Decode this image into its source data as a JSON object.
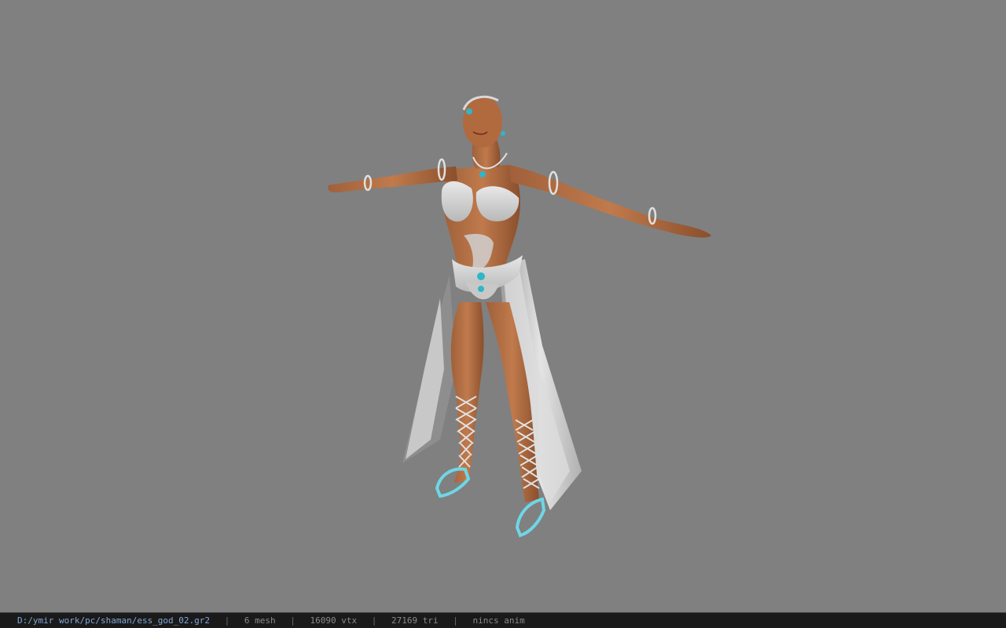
{
  "viewer": {
    "background_color": "#808080",
    "model": {
      "subject": "T-pose female character model with white lace outfit and turquoise jewelry",
      "icon": "character-model"
    }
  },
  "status_bar": {
    "file_path": "D:/ymir work/pc/shaman/ess_god_02.gr2",
    "mesh": "6 mesh",
    "vertices": "16090 vtx",
    "triangles": "27169 tri",
    "anim": "nincs anim",
    "separator": "|"
  }
}
